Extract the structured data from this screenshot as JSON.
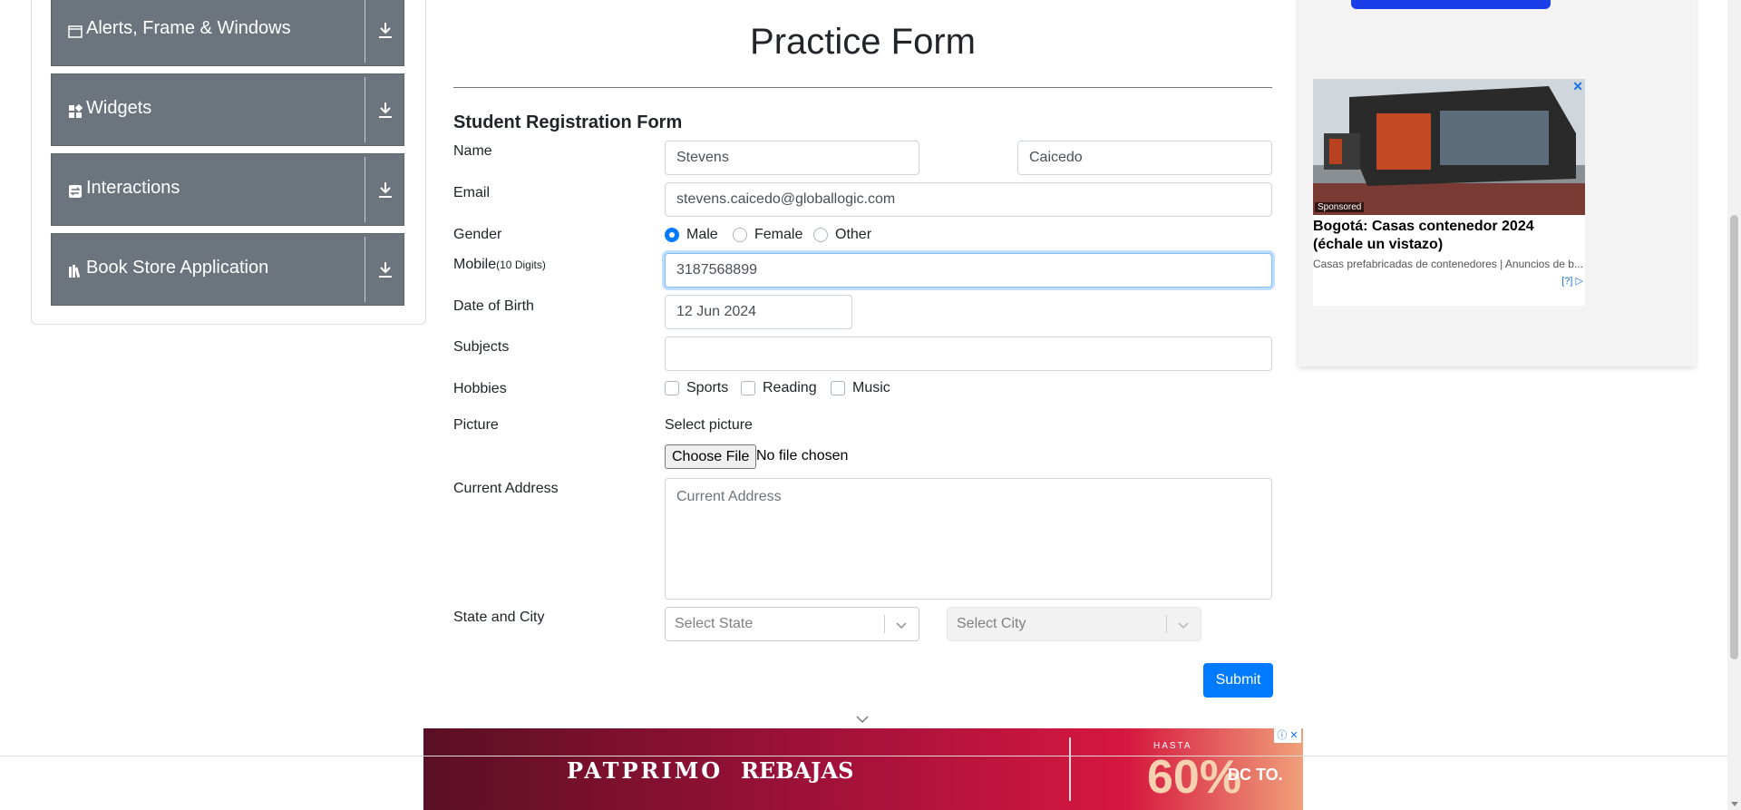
{
  "sidebar": {
    "groups": [
      {
        "label": "Alerts, Frame & Windows",
        "icon": "window-icon"
      },
      {
        "label": "Widgets",
        "icon": "widgets-grid-icon"
      },
      {
        "label": "Interactions",
        "icon": "interactions-icon"
      },
      {
        "label": "Book Store Application",
        "icon": "books-icon"
      }
    ]
  },
  "form": {
    "title": "Practice Form",
    "subtitle": "Student Registration Form",
    "labels": {
      "name": "Name",
      "email": "Email",
      "gender": "Gender",
      "mobile": "Mobile",
      "mobile_hint": "(10 Digits)",
      "dob": "Date of Birth",
      "subjects": "Subjects",
      "hobbies": "Hobbies",
      "picture": "Picture",
      "address": "Current Address",
      "state_city": "State and City"
    },
    "first_name": "Stevens",
    "last_name": "Caicedo",
    "email": "stevens.caicedo@globallogic.com",
    "gender_options": [
      "Male",
      "Female",
      "Other"
    ],
    "gender_selected": "Male",
    "mobile": "3187568899",
    "dob": "12 Jun 2024",
    "subjects": "",
    "hobbies": [
      "Sports",
      "Reading",
      "Music"
    ],
    "picture_label": "Select picture",
    "file_button": "Choose File",
    "file_status": "No file chosen",
    "address_placeholder": "Current Address",
    "state_placeholder": "Select State",
    "city_placeholder": "Select City",
    "submit": "Submit"
  },
  "side_ad": {
    "sponsored": "Sponsored",
    "close": "✕",
    "headline": "Bogotá: Casas contenedor 2024 (échale un vistazo)",
    "description": "Casas prefabricadas de contenedores | Anuncios de b...",
    "adchoices": "[?] ▷"
  },
  "banner_ad": {
    "brand": "PATPRIMO",
    "promo": "REBAJAS",
    "hasta": "HASTA",
    "percent": "60%",
    "dcto": "DC TO.",
    "close": "ⓘ ✕"
  },
  "colors": {
    "accent": "#007bff",
    "sidebar_group": "#6c757d",
    "banner": "#a0113a"
  }
}
